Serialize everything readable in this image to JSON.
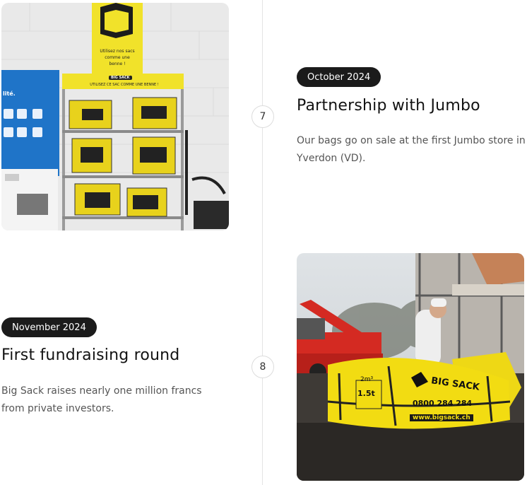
{
  "entries": [
    {
      "step": "7",
      "date": "October 2024",
      "title": "Partnership with Jumbo",
      "description": "Our bags go on sale at the first Jumbo store in Yverdon (VD)."
    },
    {
      "step": "8",
      "date": "November 2024",
      "title": "First fundraising round",
      "description": "Big Sack raises nearly one million francs from private investors."
    }
  ],
  "photo_store": {
    "poster_text": "Utilisez nos sacs comme une benne !",
    "shelf_banner": "UTILISEZ CE SAC COMME UNE BENNE !",
    "shelf_brand": "BIG SACK",
    "blue_panel_text": "lité."
  },
  "photo_site": {
    "brand": "BIG SACK",
    "capacity": "1.5t",
    "volume": "2m³",
    "phone": "0800 284 284",
    "website": "www.bigsack.ch"
  },
  "colors": {
    "brand_yellow": "#f3e21a",
    "pill_bg": "#1b1b1b",
    "line": "#e4e4e4"
  }
}
